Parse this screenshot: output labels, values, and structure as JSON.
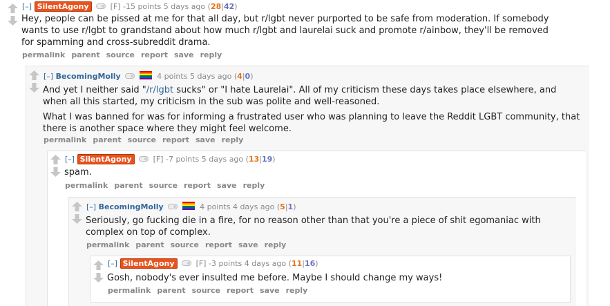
{
  "ui": {
    "collapse": "[–]",
    "buttons": [
      "permalink",
      "parent",
      "source",
      "report",
      "save",
      "reply"
    ]
  },
  "comments": [
    {
      "author": "SilentAgony",
      "flair": "[F]",
      "points": "-15 points",
      "time": "5 days ago",
      "ups": "28",
      "downs": "42",
      "body": [
        "Hey, people can be pissed at me for that all day, but r/lgbt never purported to be safe from moderation. If somebody wants to use r/lgbt to grandstand about how much r/lgbt and laurelai suck and promote r/ainbow, they'll be removed for spamming and cross-subreddit drama."
      ]
    },
    {
      "author": "BecomingMolly",
      "points": "4 points",
      "time": "5 days ago",
      "ups": "4",
      "downs": "0",
      "body_p1_before": "And yet I neither said \"",
      "body_p1_link": "/r/lgbt",
      "body_p1_after": " sucks\" or \"I hate Laurelai\". All of my criticism these days takes place elsewhere, and when all this started, my criticism in the sub was polite and well-reasoned.",
      "body_p2": "What I was banned for was for informing a frustrated user who was planning to leave the Reddit LGBT community, that there is another space where they might feel welcome."
    },
    {
      "author": "SilentAgony",
      "flair": "[F]",
      "points": "-7 points",
      "time": "5 days ago",
      "ups": "13",
      "downs": "19",
      "body": [
        "spam."
      ]
    },
    {
      "author": "BecomingMolly",
      "points": "4 points",
      "time": "4 days ago",
      "ups": "5",
      "downs": "1",
      "body": [
        "Seriously, go fucking die in a fire, for no reason other than that you're a piece of shit egomaniac with complex on top of complex."
      ]
    },
    {
      "author": "SilentAgony",
      "flair": "[F]",
      "points": "-3 points",
      "time": "4 days ago",
      "ups": "11",
      "downs": "16",
      "body": [
        "Gosh, nobody's ever insulted me before. Maybe I should change my ways!"
      ]
    }
  ]
}
